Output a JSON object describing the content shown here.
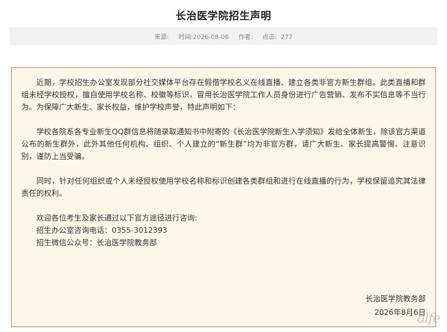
{
  "article": {
    "title": "长治医学院招生声明",
    "meta": {
      "source_label": "来源:",
      "time_label": "时间:",
      "time_value": "2026-08-06",
      "author_label": "作者:",
      "views_label": "点击:",
      "views_value": "277"
    },
    "paragraphs": [
      "近期，学校招生办公室发现部分社交媒体平台存在假借学校名义在线直播、建立各类非官方新生群组。此类直播和群组未经学校授权，擅自使用学校名称、校徽等标识，冒用长治医学院工作人员身份进行广告营销、发布不实信息等不当行为。为保障广大新生、家长权益，维护学校声誉，特此声明如下：",
      "学校各院系各专业新生QQ群信息将随录取通知书中附寄的《长治医学院新生入学须知》发给全体新生，除该官方渠道公布的新生群外，此外其他任何机构、组织、个人建立的“新生群”均为非官方群，请广大新生、家长提高警惕、注意识别，谨防上当受骗。",
      "同时，针对任何组织或个人未经授权使用学校名称和标识创建各类群组和进行在线直播的行为，学校保留追究其法律责任的权利。"
    ],
    "contact": {
      "intro": "欢迎各位考生及家长通过以下官方途径进行咨询:",
      "phone_line": "招生办公室咨询电话：0355-3012393",
      "wechat_line": "招生微信公众号：长治医学院教务部"
    },
    "signature": {
      "org": "长治医学院教务部",
      "date": "2026年8月6日"
    },
    "watermark_text": "alfe"
  }
}
